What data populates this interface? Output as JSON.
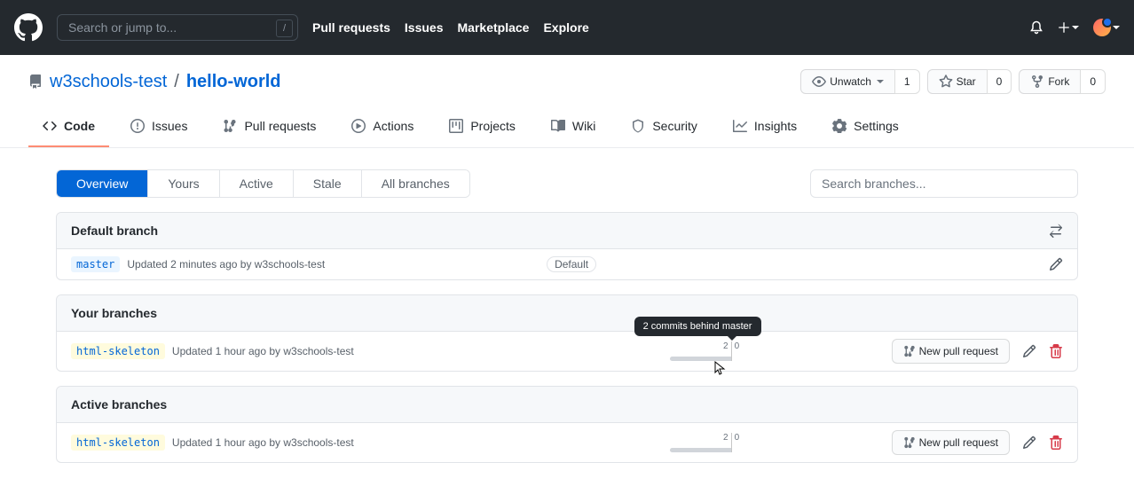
{
  "header": {
    "search_placeholder": "Search or jump to...",
    "slash_hint": "/",
    "nav": {
      "pulls": "Pull requests",
      "issues": "Issues",
      "marketplace": "Marketplace",
      "explore": "Explore"
    }
  },
  "repo": {
    "owner": "w3schools-test",
    "separator": "/",
    "name": "hello-world",
    "watch": {
      "label": "Unwatch",
      "count": "1"
    },
    "star": {
      "label": "Star",
      "count": "0"
    },
    "fork": {
      "label": "Fork",
      "count": "0"
    },
    "tabs": {
      "code": "Code",
      "issues": "Issues",
      "pulls": "Pull requests",
      "actions": "Actions",
      "projects": "Projects",
      "wiki": "Wiki",
      "security": "Security",
      "insights": "Insights",
      "settings": "Settings"
    }
  },
  "branches": {
    "filters": {
      "overview": "Overview",
      "yours": "Yours",
      "active": "Active",
      "stale": "Stale",
      "all": "All branches"
    },
    "search_placeholder": "Search branches...",
    "default": {
      "title": "Default branch",
      "branch": "master",
      "meta": "Updated 2 minutes ago by w3schools-test",
      "chip": "Default"
    },
    "yours": {
      "title": "Your branches",
      "items": [
        {
          "branch": "html-skeleton",
          "meta": "Updated 1 hour ago by w3schools-test",
          "behind": "2",
          "ahead": "0",
          "pr_label": "New pull request"
        }
      ]
    },
    "active": {
      "title": "Active branches",
      "items": [
        {
          "branch": "html-skeleton",
          "meta": "Updated 1 hour ago by w3schools-test",
          "behind": "2",
          "ahead": "0",
          "pr_label": "New pull request"
        }
      ]
    },
    "tooltip": "2 commits behind master"
  }
}
